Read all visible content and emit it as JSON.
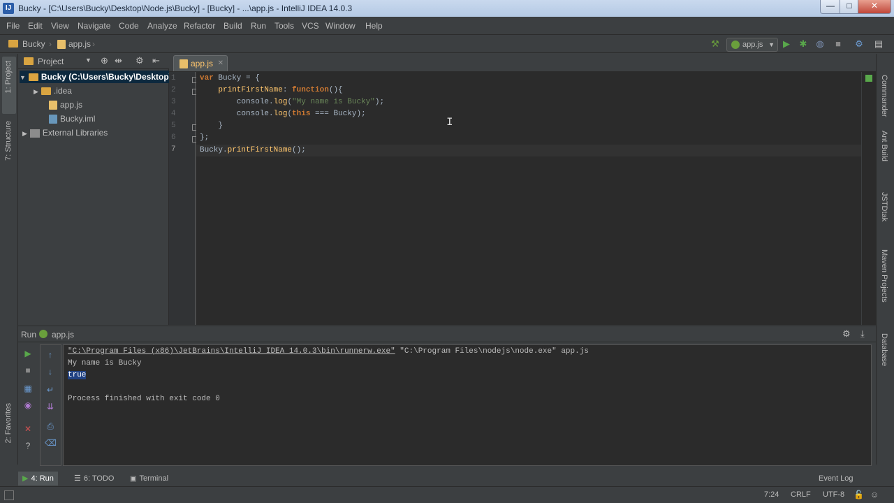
{
  "window": {
    "title": "Bucky - [C:\\Users\\Bucky\\Desktop\\Node.js\\Bucky] - [Bucky] - ...\\app.js - IntelliJ IDEA 14.0.3",
    "min": "—",
    "max": "□",
    "close": "✕"
  },
  "menu": [
    "File",
    "Edit",
    "View",
    "Navigate",
    "Code",
    "Analyze",
    "Refactor",
    "Build",
    "Run",
    "Tools",
    "VCS",
    "Window",
    "Help"
  ],
  "breadcrumb": {
    "project": "Bucky",
    "file": "app.js"
  },
  "toolbar": {
    "run_config": "app.js"
  },
  "left_strip": {
    "project": "1: Project",
    "structure": "7: Structure",
    "favorites": "2: Favorites"
  },
  "project_panel": {
    "title": "Project",
    "tree": [
      {
        "label": "Bucky (C:\\Users\\Bucky\\Desktop\\",
        "type": "root"
      },
      {
        "label": ".idea",
        "type": "folder"
      },
      {
        "label": "app.js",
        "type": "js"
      },
      {
        "label": "Bucky.iml",
        "type": "iml"
      },
      {
        "label": "External Libraries",
        "type": "libs"
      }
    ]
  },
  "editor": {
    "tab": "app.js",
    "line_numbers": [
      "1",
      "2",
      "3",
      "4",
      "5",
      "6",
      "7"
    ],
    "code": [
      [
        {
          "t": "var ",
          "c": "kw"
        },
        {
          "t": "Bucky = {",
          "c": ""
        }
      ],
      [
        {
          "t": "    printFirstName",
          "c": "fn"
        },
        {
          "t": ": ",
          "c": ""
        },
        {
          "t": "function",
          "c": "kw"
        },
        {
          "t": "(){",
          "c": ""
        }
      ],
      [
        {
          "t": "        console.",
          "c": ""
        },
        {
          "t": "log",
          "c": "fn"
        },
        {
          "t": "(",
          "c": ""
        },
        {
          "t": "\"My name is Bucky\"",
          "c": "str"
        },
        {
          "t": ");",
          "c": ""
        }
      ],
      [
        {
          "t": "        console.",
          "c": ""
        },
        {
          "t": "log",
          "c": "fn"
        },
        {
          "t": "(",
          "c": ""
        },
        {
          "t": "this",
          "c": "kw"
        },
        {
          "t": " === Bucky);",
          "c": ""
        }
      ],
      [
        {
          "t": "    }",
          "c": ""
        }
      ],
      [
        {
          "t": "};",
          "c": ""
        }
      ],
      [
        {
          "t": "Bucky.",
          "c": ""
        },
        {
          "t": "printFirstName",
          "c": "fn"
        },
        {
          "t": "();",
          "c": ""
        }
      ]
    ]
  },
  "right_strip": [
    "Commander",
    "Ant Build",
    "JSTDtak",
    "Maven Projects",
    "Database"
  ],
  "run_panel": {
    "title_prefix": "Run",
    "title_config": "app.js",
    "console": {
      "cmd_exe": "\"C:\\Program Files (x86)\\JetBrains\\IntelliJ IDEA 14.0.3\\bin\\runnerw.exe\"",
      "cmd_rest": " \"C:\\Program Files\\nodejs\\node.exe\" app.js",
      "out1": "My name is Bucky",
      "out2": "true",
      "exit": "Process finished with exit code 0"
    }
  },
  "tool_tabs": {
    "run": "4: Run",
    "todo": "6: TODO",
    "terminal": "Terminal"
  },
  "status": {
    "position": "7:24",
    "line_sep": "CRLF",
    "encoding": "UTF-8",
    "event_log": "Event Log"
  }
}
